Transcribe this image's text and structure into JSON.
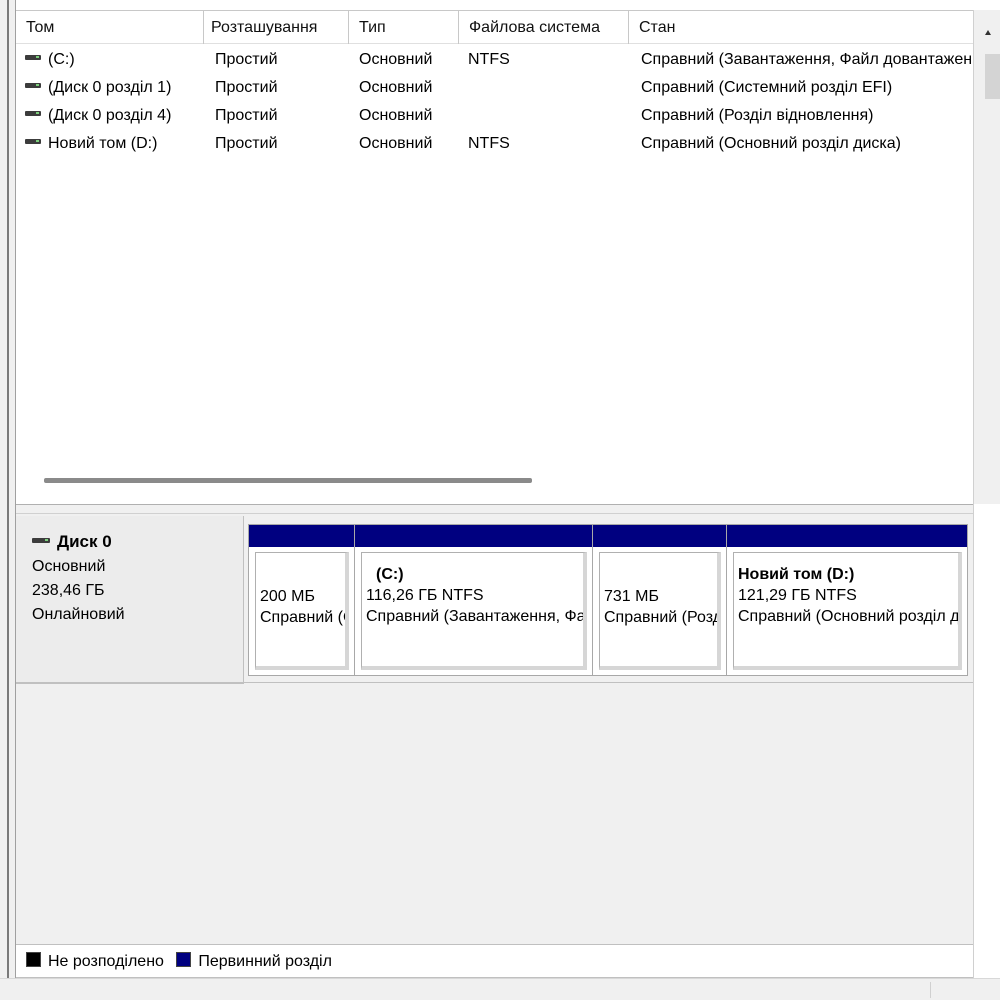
{
  "volume_list": {
    "columns": [
      "Том",
      "Розташування",
      "Тип",
      "Файлова система",
      "Стан"
    ],
    "rows": [
      {
        "volume": "(C:)",
        "layout": "Простий",
        "type": "Основний",
        "fs": "NTFS",
        "status": "Справний (Завантаження, Файл довантаження, Аварійний дамп, Основний розділ диска)"
      },
      {
        "volume": "(Диск 0 розділ 1)",
        "layout": "Простий",
        "type": "Основний",
        "fs": "",
        "status": "Справний (Системний розділ EFI)"
      },
      {
        "volume": "(Диск 0 розділ 4)",
        "layout": "Простий",
        "type": "Основний",
        "fs": "",
        "status": "Справний (Розділ відновлення)"
      },
      {
        "volume": "Новий том (D:)",
        "layout": "Простий",
        "type": "Основний",
        "fs": "NTFS",
        "status": "Справний (Основний розділ диска)"
      }
    ]
  },
  "disk": {
    "name": "Диск 0",
    "type": "Основний",
    "size": "238,46 ГБ",
    "state": "Онлайновий",
    "partitions": [
      {
        "name": "",
        "size": "200 МБ",
        "status": "Справний (Системний розділ EFI)"
      },
      {
        "name": "(C:)",
        "size": "116,26 ГБ NTFS",
        "status": "Справний (Завантаження, Файл довантаження, Аварійний дамп)"
      },
      {
        "name": "",
        "size": "731 МБ",
        "status": "Справний (Розділ відновлення)"
      },
      {
        "name": "Новий том  (D:)",
        "size": "121,29 ГБ NTFS",
        "status": "Справний (Основний розділ диска)"
      }
    ]
  },
  "legend": {
    "items": [
      {
        "label": "Не розподілено",
        "color": "#000000"
      },
      {
        "label": "Первинний розділ",
        "color": "#000080"
      }
    ]
  },
  "colors": {
    "primary_partition": "#000080",
    "unallocated": "#000000",
    "pane_background": "#f0f0f0"
  },
  "icons": {
    "volume": "disk-drive-icon",
    "disk": "disk-drive-icon"
  }
}
